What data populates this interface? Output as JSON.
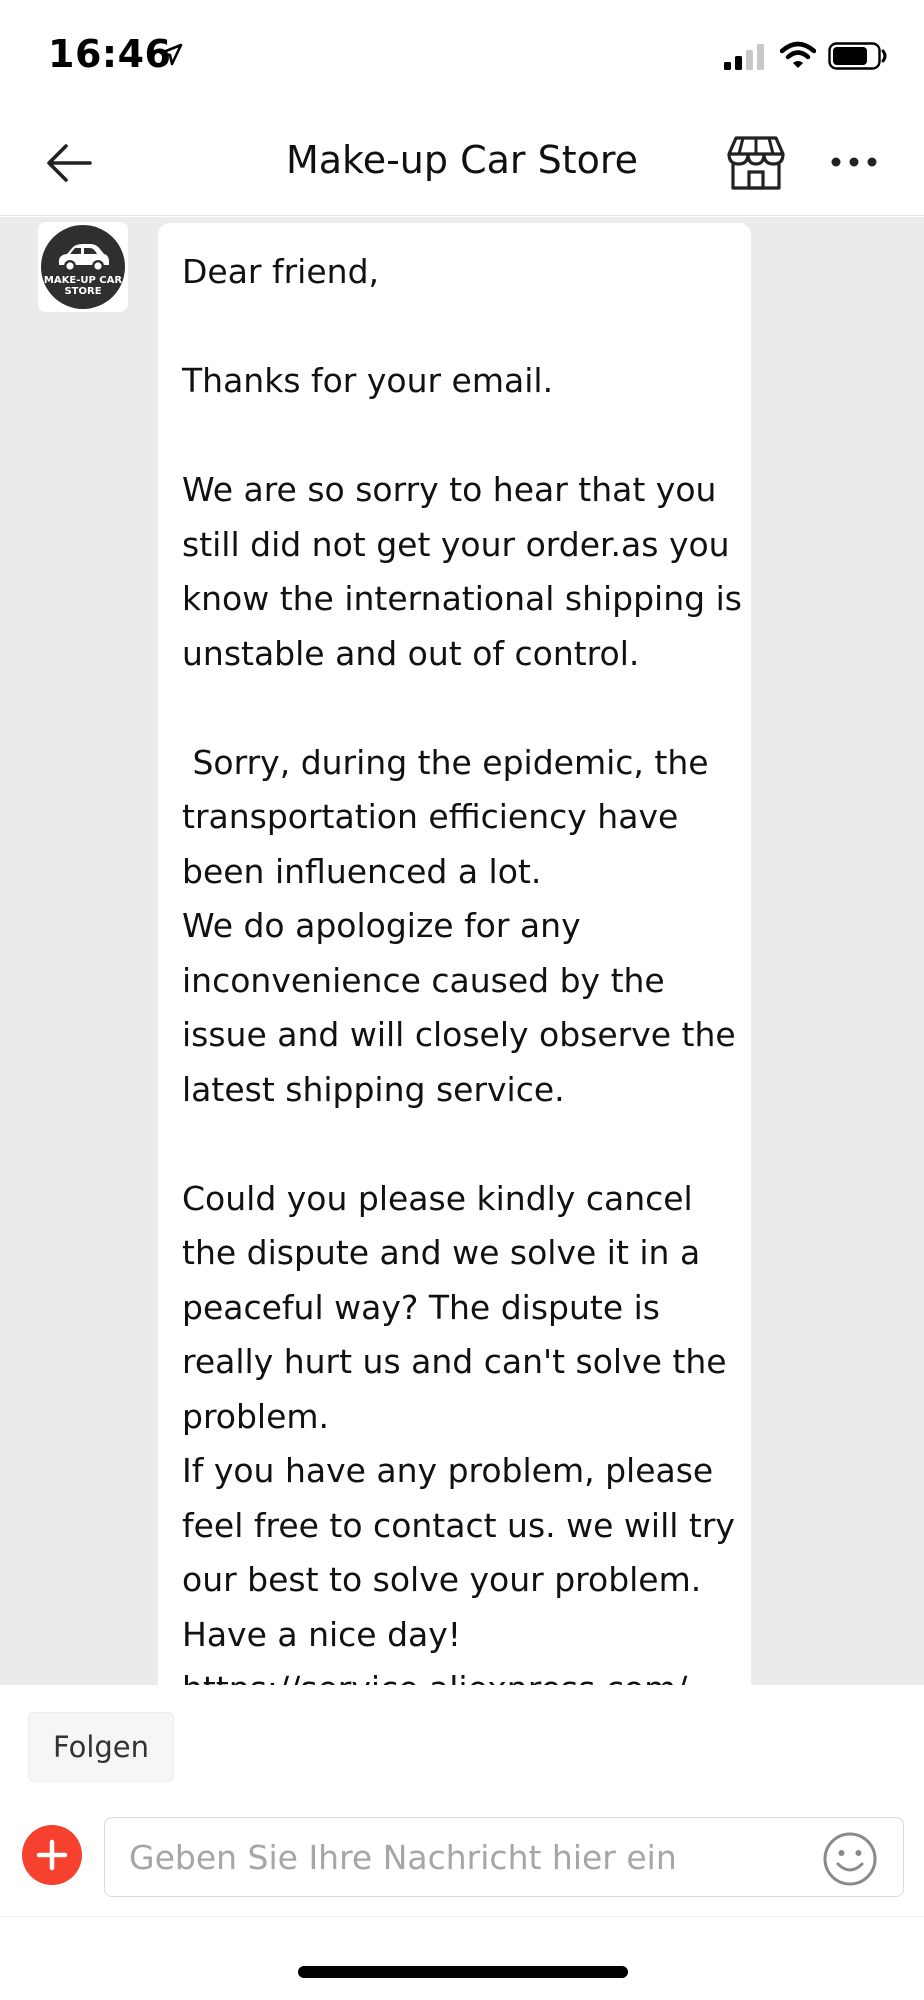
{
  "status_bar": {
    "time": "16:46",
    "icons": [
      "location-arrow-icon",
      "signal-icon",
      "wifi-icon",
      "battery-icon"
    ]
  },
  "header": {
    "title": "Make-up Car Store",
    "icons": [
      "back-arrow-icon",
      "store-icon",
      "more-icon"
    ]
  },
  "store_avatar": {
    "logo_text": "MAKE-UP CAR STORE"
  },
  "message": {
    "lines": [
      "Dear friend,",
      "",
      "Thanks for your email.",
      "",
      "We are so sorry to hear that you",
      "still did not get your order.as you",
      "know the international shipping is",
      "unstable and out of control.",
      "",
      " Sorry, during the epidemic, the",
      "transportation efficiency have",
      "been influenced a lot.",
      "We do apologize for any",
      "inconvenience caused by the",
      "issue and will closely observe the",
      "latest shipping service.",
      "",
      "Could you please kindly cancel",
      "the dispute and we solve it in a",
      "peaceful way? The dispute is",
      "really hurt us and can't solve the",
      "problem.",
      "If you have any problem, please",
      "feel free to contact us. we will try",
      "our best to solve your problem.",
      "Have a nice day!",
      "https://service.aliexpress.com/"
    ]
  },
  "follow_button": {
    "label": "Folgen"
  },
  "composer": {
    "placeholder": "Geben Sie Ihre Nachricht hier ein",
    "value": ""
  },
  "colors": {
    "accent": "#f5412e",
    "chat_background": "#ebebeb"
  }
}
